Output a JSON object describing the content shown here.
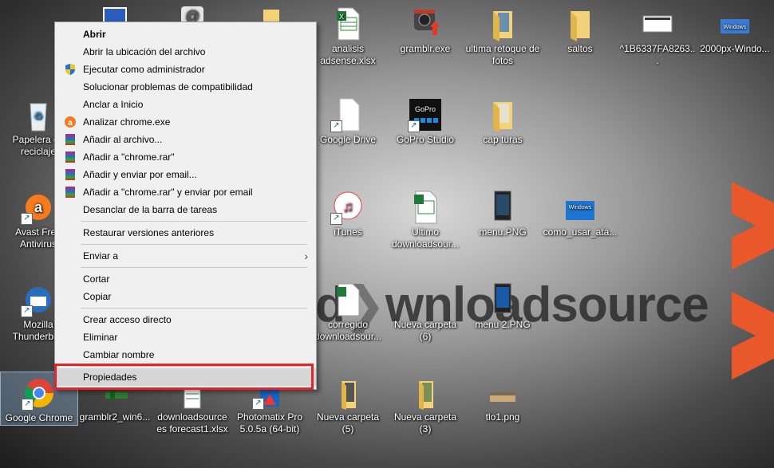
{
  "watermark": {
    "part1": "d",
    "part2": "wnloadsource"
  },
  "desktop_icons": [
    {
      "label": "analisis adsense.xlsx",
      "icon": "excel-file-icon",
      "shortcut": false
    },
    {
      "label": "gramblr.exe",
      "icon": "gramblr-icon",
      "shortcut": false
    },
    {
      "label": "ultima retoque de fotos",
      "icon": "folder-photos-icon",
      "shortcut": false
    },
    {
      "label": "saltos",
      "icon": "folder-icon",
      "shortcut": false
    },
    {
      "label": "^1B6337FA8263...",
      "icon": "screenshot-file-icon",
      "shortcut": false
    },
    {
      "label": "2000px-Windo...",
      "icon": "windows-image-icon",
      "shortcut": false
    },
    {
      "label": "Papelera de reciclaje",
      "icon": "recycle-bin-icon",
      "shortcut": false
    },
    {
      "label": "Google Drive",
      "icon": "google-drive-icon",
      "shortcut": true
    },
    {
      "label": "GoPro Studio",
      "icon": "gopro-icon",
      "shortcut": true
    },
    {
      "label": "cap turas",
      "icon": "folder-photos-icon",
      "shortcut": false
    },
    {
      "label": "Avast Free Antivirus",
      "icon": "avast-icon",
      "shortcut": true
    },
    {
      "label": "iTunes",
      "icon": "itunes-icon",
      "shortcut": true
    },
    {
      "label": "Ultimo downloadsour...",
      "icon": "excel-file-icon",
      "shortcut": false
    },
    {
      "label": "menu.PNG",
      "icon": "phone-image-icon",
      "shortcut": false
    },
    {
      "label": "como_usar_ata...",
      "icon": "windows-image-icon",
      "shortcut": false
    },
    {
      "label": "Mozilla Thunderbird",
      "icon": "thunderbird-icon",
      "shortcut": true
    },
    {
      "label": "corregido downloadsour...",
      "icon": "excel-file-icon",
      "shortcut": false
    },
    {
      "label": "Nueva carpeta (6)",
      "icon": "folder-icon",
      "shortcut": false
    },
    {
      "label": "menu 2.PNG",
      "icon": "phone-image-icon",
      "shortcut": false
    },
    {
      "label": "Google Chrome",
      "icon": "chrome-icon",
      "shortcut": true
    },
    {
      "label": "gramblr2_win6...",
      "icon": "gramblr-icon",
      "shortcut": false
    },
    {
      "label": "downloadsource es forecast1.xlsx",
      "icon": "excel-file-icon",
      "shortcut": false
    },
    {
      "label": "Photomatix Pro 5.0.5a (64-bit)",
      "icon": "photomatix-icon",
      "shortcut": true
    },
    {
      "label": "Nueva carpeta (5)",
      "icon": "folder-icon",
      "shortcut": false
    },
    {
      "label": "Nueva carpeta (3)",
      "icon": "folder-icon",
      "shortcut": false
    },
    {
      "label": "tlo1.png",
      "icon": "image-file-icon",
      "shortcut": false
    }
  ],
  "context_menu": {
    "items": [
      {
        "label": "Abrir",
        "icon": "",
        "bold": true
      },
      {
        "label": "Abrir la ubicación del archivo",
        "icon": ""
      },
      {
        "label": "Ejecutar como administrador",
        "icon": "uac-shield-icon"
      },
      {
        "label": "Solucionar problemas de compatibilidad",
        "icon": ""
      },
      {
        "label": "Anclar a Inicio",
        "icon": ""
      },
      {
        "label": "Analizar chrome.exe",
        "icon": "avast-icon"
      },
      {
        "label": "Añadir al archivo...",
        "icon": "winrar-icon"
      },
      {
        "label": "Añadir a \"chrome.rar\"",
        "icon": "winrar-icon"
      },
      {
        "label": "Añadir y enviar por email...",
        "icon": "winrar-icon"
      },
      {
        "label": "Añadir a \"chrome.rar\" y enviar por email",
        "icon": "winrar-icon"
      },
      {
        "label": "Desanclar de la barra de tareas",
        "icon": ""
      },
      {
        "label": "Restaurar versiones anteriores",
        "icon": ""
      },
      {
        "label": "Enviar a",
        "icon": "",
        "submenu_arrow": "›"
      },
      {
        "label": "Cortar",
        "icon": ""
      },
      {
        "label": "Copiar",
        "icon": ""
      },
      {
        "label": "Crear acceso directo",
        "icon": ""
      },
      {
        "label": "Eliminar",
        "icon": ""
      },
      {
        "label": "Cambiar nombre",
        "icon": ""
      },
      {
        "label": "Propiedades",
        "icon": "",
        "highlighted": true
      }
    ]
  },
  "colors": {
    "highlight_box": "#e3242b",
    "chevron": "#e8582a",
    "menu_bg": "#f0f0f0"
  }
}
